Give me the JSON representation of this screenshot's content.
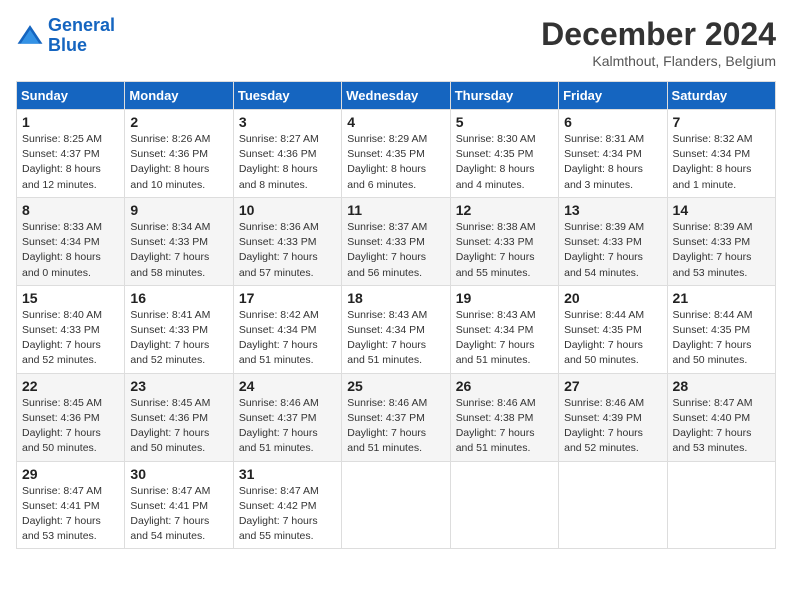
{
  "header": {
    "logo_line1": "General",
    "logo_line2": "Blue",
    "month_title": "December 2024",
    "location": "Kalmthout, Flanders, Belgium"
  },
  "weekdays": [
    "Sunday",
    "Monday",
    "Tuesday",
    "Wednesday",
    "Thursday",
    "Friday",
    "Saturday"
  ],
  "weeks": [
    [
      {
        "day": "1",
        "sunrise": "Sunrise: 8:25 AM",
        "sunset": "Sunset: 4:37 PM",
        "daylight": "Daylight: 8 hours and 12 minutes."
      },
      {
        "day": "2",
        "sunrise": "Sunrise: 8:26 AM",
        "sunset": "Sunset: 4:36 PM",
        "daylight": "Daylight: 8 hours and 10 minutes."
      },
      {
        "day": "3",
        "sunrise": "Sunrise: 8:27 AM",
        "sunset": "Sunset: 4:36 PM",
        "daylight": "Daylight: 8 hours and 8 minutes."
      },
      {
        "day": "4",
        "sunrise": "Sunrise: 8:29 AM",
        "sunset": "Sunset: 4:35 PM",
        "daylight": "Daylight: 8 hours and 6 minutes."
      },
      {
        "day": "5",
        "sunrise": "Sunrise: 8:30 AM",
        "sunset": "Sunset: 4:35 PM",
        "daylight": "Daylight: 8 hours and 4 minutes."
      },
      {
        "day": "6",
        "sunrise": "Sunrise: 8:31 AM",
        "sunset": "Sunset: 4:34 PM",
        "daylight": "Daylight: 8 hours and 3 minutes."
      },
      {
        "day": "7",
        "sunrise": "Sunrise: 8:32 AM",
        "sunset": "Sunset: 4:34 PM",
        "daylight": "Daylight: 8 hours and 1 minute."
      }
    ],
    [
      {
        "day": "8",
        "sunrise": "Sunrise: 8:33 AM",
        "sunset": "Sunset: 4:34 PM",
        "daylight": "Daylight: 8 hours and 0 minutes."
      },
      {
        "day": "9",
        "sunrise": "Sunrise: 8:34 AM",
        "sunset": "Sunset: 4:33 PM",
        "daylight": "Daylight: 7 hours and 58 minutes."
      },
      {
        "day": "10",
        "sunrise": "Sunrise: 8:36 AM",
        "sunset": "Sunset: 4:33 PM",
        "daylight": "Daylight: 7 hours and 57 minutes."
      },
      {
        "day": "11",
        "sunrise": "Sunrise: 8:37 AM",
        "sunset": "Sunset: 4:33 PM",
        "daylight": "Daylight: 7 hours and 56 minutes."
      },
      {
        "day": "12",
        "sunrise": "Sunrise: 8:38 AM",
        "sunset": "Sunset: 4:33 PM",
        "daylight": "Daylight: 7 hours and 55 minutes."
      },
      {
        "day": "13",
        "sunrise": "Sunrise: 8:39 AM",
        "sunset": "Sunset: 4:33 PM",
        "daylight": "Daylight: 7 hours and 54 minutes."
      },
      {
        "day": "14",
        "sunrise": "Sunrise: 8:39 AM",
        "sunset": "Sunset: 4:33 PM",
        "daylight": "Daylight: 7 hours and 53 minutes."
      }
    ],
    [
      {
        "day": "15",
        "sunrise": "Sunrise: 8:40 AM",
        "sunset": "Sunset: 4:33 PM",
        "daylight": "Daylight: 7 hours and 52 minutes."
      },
      {
        "day": "16",
        "sunrise": "Sunrise: 8:41 AM",
        "sunset": "Sunset: 4:33 PM",
        "daylight": "Daylight: 7 hours and 52 minutes."
      },
      {
        "day": "17",
        "sunrise": "Sunrise: 8:42 AM",
        "sunset": "Sunset: 4:34 PM",
        "daylight": "Daylight: 7 hours and 51 minutes."
      },
      {
        "day": "18",
        "sunrise": "Sunrise: 8:43 AM",
        "sunset": "Sunset: 4:34 PM",
        "daylight": "Daylight: 7 hours and 51 minutes."
      },
      {
        "day": "19",
        "sunrise": "Sunrise: 8:43 AM",
        "sunset": "Sunset: 4:34 PM",
        "daylight": "Daylight: 7 hours and 51 minutes."
      },
      {
        "day": "20",
        "sunrise": "Sunrise: 8:44 AM",
        "sunset": "Sunset: 4:35 PM",
        "daylight": "Daylight: 7 hours and 50 minutes."
      },
      {
        "day": "21",
        "sunrise": "Sunrise: 8:44 AM",
        "sunset": "Sunset: 4:35 PM",
        "daylight": "Daylight: 7 hours and 50 minutes."
      }
    ],
    [
      {
        "day": "22",
        "sunrise": "Sunrise: 8:45 AM",
        "sunset": "Sunset: 4:36 PM",
        "daylight": "Daylight: 7 hours and 50 minutes."
      },
      {
        "day": "23",
        "sunrise": "Sunrise: 8:45 AM",
        "sunset": "Sunset: 4:36 PM",
        "daylight": "Daylight: 7 hours and 50 minutes."
      },
      {
        "day": "24",
        "sunrise": "Sunrise: 8:46 AM",
        "sunset": "Sunset: 4:37 PM",
        "daylight": "Daylight: 7 hours and 51 minutes."
      },
      {
        "day": "25",
        "sunrise": "Sunrise: 8:46 AM",
        "sunset": "Sunset: 4:37 PM",
        "daylight": "Daylight: 7 hours and 51 minutes."
      },
      {
        "day": "26",
        "sunrise": "Sunrise: 8:46 AM",
        "sunset": "Sunset: 4:38 PM",
        "daylight": "Daylight: 7 hours and 51 minutes."
      },
      {
        "day": "27",
        "sunrise": "Sunrise: 8:46 AM",
        "sunset": "Sunset: 4:39 PM",
        "daylight": "Daylight: 7 hours and 52 minutes."
      },
      {
        "day": "28",
        "sunrise": "Sunrise: 8:47 AM",
        "sunset": "Sunset: 4:40 PM",
        "daylight": "Daylight: 7 hours and 53 minutes."
      }
    ],
    [
      {
        "day": "29",
        "sunrise": "Sunrise: 8:47 AM",
        "sunset": "Sunset: 4:41 PM",
        "daylight": "Daylight: 7 hours and 53 minutes."
      },
      {
        "day": "30",
        "sunrise": "Sunrise: 8:47 AM",
        "sunset": "Sunset: 4:41 PM",
        "daylight": "Daylight: 7 hours and 54 minutes."
      },
      {
        "day": "31",
        "sunrise": "Sunrise: 8:47 AM",
        "sunset": "Sunset: 4:42 PM",
        "daylight": "Daylight: 7 hours and 55 minutes."
      },
      null,
      null,
      null,
      null
    ]
  ]
}
